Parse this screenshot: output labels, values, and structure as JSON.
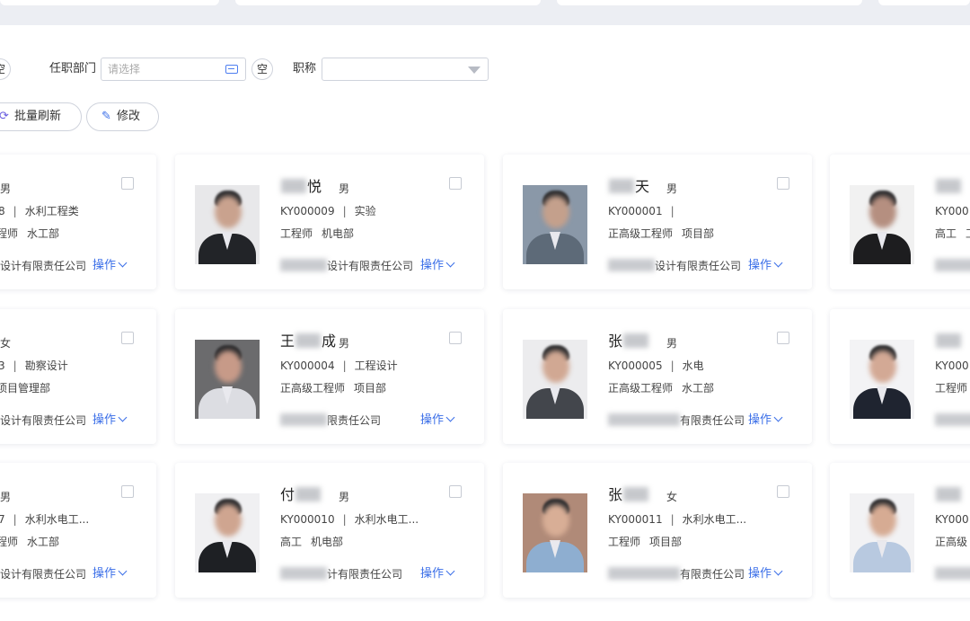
{
  "filters": {
    "clear_label": "空",
    "dept_label": "任职部门",
    "dept_placeholder": "请选择",
    "title_label": "职称",
    "title_value": ""
  },
  "actions": {
    "refresh_label": "批量刷新",
    "edit_label": "修改"
  },
  "employee_cards": [
    [
      {
        "name_pre": "",
        "name_post": "",
        "gender": "男",
        "code": "",
        "code_tail": "8",
        "sep": "|",
        "specialty": "水利工程类",
        "title": "程师",
        "dept": "水工部",
        "company": "设计有限责任公司",
        "action": "操作"
      },
      {
        "name_pre": "",
        "name_post": "悦",
        "gender": "男",
        "code": "KY000009",
        "sep": "|",
        "specialty": "实验",
        "title": "工程师",
        "dept": "机电部",
        "company": "设计有限责任公司",
        "action": "操作"
      },
      {
        "name_pre": "",
        "name_post": "天",
        "gender": "男",
        "code": "KY000001",
        "sep": "|",
        "specialty": "",
        "title": "正高级工程师",
        "dept": "项目部",
        "company": "设计有限责任公司",
        "action": "操作"
      },
      {
        "name_pre": "",
        "name_post": "",
        "gender": "",
        "code": "KY000",
        "sep": "",
        "specialty": "",
        "title": "高工",
        "dept": "工",
        "company": "",
        "action": ""
      }
    ],
    [
      {
        "name_pre": "",
        "name_post": "",
        "gender": "女",
        "code": "",
        "code_tail": "3",
        "sep": "|",
        "specialty": "勘察设计",
        "title": "项目管理部",
        "dept": "",
        "company": "设计有限责任公司",
        "action": "操作"
      },
      {
        "name_pre": "王",
        "name_post": "成",
        "gender": "男",
        "code": "KY000004",
        "sep": "|",
        "specialty": "工程设计",
        "title": "正高级工程师",
        "dept": "项目部",
        "company": "限责任公司",
        "action": "操作"
      },
      {
        "name_pre": "张",
        "name_post": "",
        "gender": "男",
        "code": "KY000005",
        "sep": "|",
        "specialty": "水电",
        "title": "正高级工程师",
        "dept": "水工部",
        "company": "有限责任公司",
        "action": "操作"
      },
      {
        "name_pre": "",
        "name_post": "",
        "gender": "",
        "code": "KY000",
        "sep": "",
        "specialty": "",
        "title": "工程师",
        "dept": "",
        "company": "",
        "action": ""
      }
    ],
    [
      {
        "name_pre": "",
        "name_post": "",
        "gender": "男",
        "code": "",
        "code_tail": "7",
        "sep": "|",
        "specialty": "水利水电工...",
        "title": "程师",
        "dept": "水工部",
        "company": "设计有限责任公司",
        "action": "操作"
      },
      {
        "name_pre": "付",
        "name_post": "",
        "gender": "男",
        "code": "KY000010",
        "sep": "|",
        "specialty": "水利水电工...",
        "title": "高工",
        "dept": "机电部",
        "company": "计有限责任公司",
        "action": "操作"
      },
      {
        "name_pre": "张",
        "name_post": "",
        "gender": "女",
        "code": "KY000011",
        "sep": "|",
        "specialty": "水利水电工...",
        "title": "工程师",
        "dept": "项目部",
        "company": "有限责任公司",
        "action": "操作"
      },
      {
        "name_pre": "",
        "name_post": "",
        "gender": "",
        "code": "KY000",
        "sep": "",
        "specialty": "",
        "title": "正高级",
        "dept": "",
        "company": "",
        "action": ""
      }
    ]
  ],
  "colors": {
    "accent": "#3a6ee8",
    "refresh_icon": "#6a5fe0",
    "page_bg": "#f2f3f7",
    "card_bg": "#ffffff"
  },
  "icons": {
    "refresh": "refresh-icon",
    "edit": "edit-icon",
    "dept_picker": "org-tree-icon",
    "dropdown": "chevron-down-icon",
    "action_menu": "chevron-down-icon"
  }
}
